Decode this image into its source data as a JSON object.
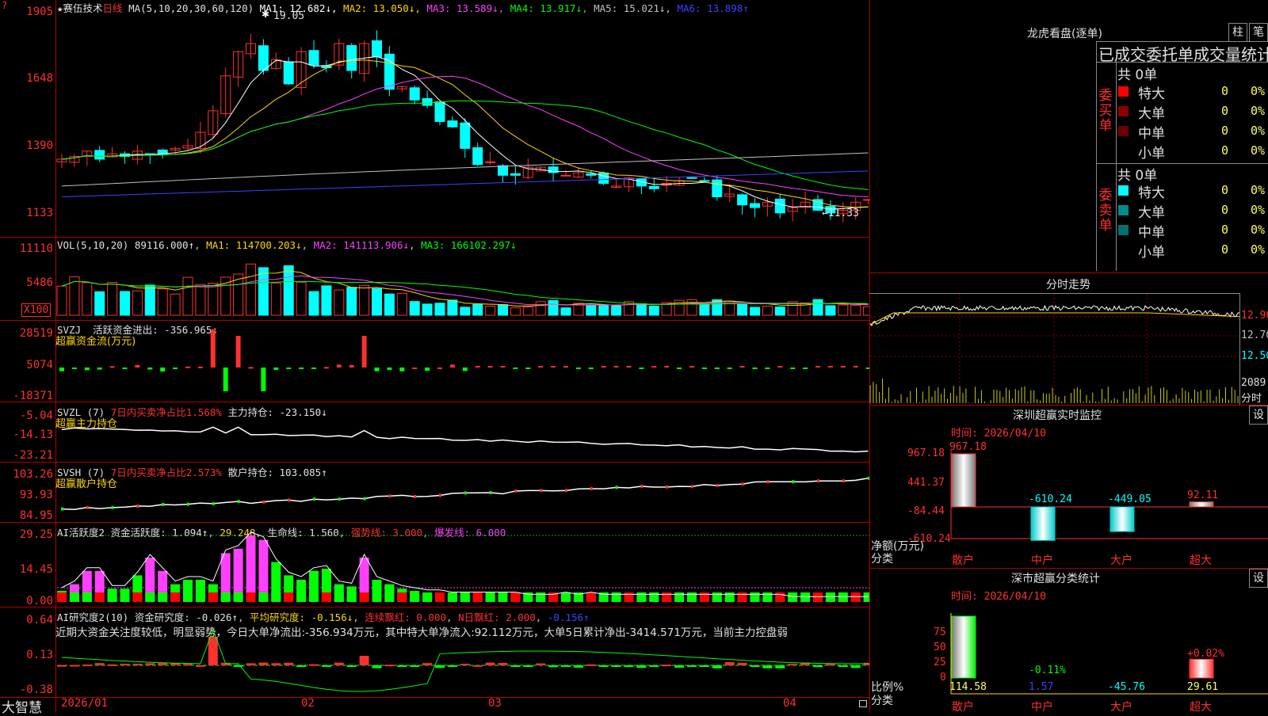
{
  "app": {
    "brand": "大智慧",
    "stock_name": "赛伍技术",
    "period": "日线",
    "star": "★",
    "marker": "?"
  },
  "price_panel": {
    "ma_header": "MA(5,10,20,30,60,120)",
    "ma_values": [
      {
        "label": "MA1:",
        "value": "12.682↓",
        "color": "#ffffff"
      },
      {
        "label": "MA2:",
        "value": "13.050↓",
        "color": "#ffd700"
      },
      {
        "label": "MA3:",
        "value": "13.589↓",
        "color": "#ff40ff"
      },
      {
        "label": "MA4:",
        "value": "13.917↓",
        "color": "#00ff00"
      },
      {
        "label": "MA5:",
        "value": "15.021↓",
        "color": "#c0c0c0"
      },
      {
        "label": "MA6:",
        "value": "13.898↑",
        "color": "#4040ff"
      }
    ],
    "y_ticks": [
      "1905",
      "1648",
      "1390",
      "1133"
    ],
    "high_label": "19.05",
    "low_label": "←11.33"
  },
  "vol_panel": {
    "header": "VOL(5,10,20)",
    "vol_value": "89116.000↑",
    "ma1": "MA1: 114700.203↓",
    "ma2": "MA2: 141113.906↓",
    "ma3": "MA3: 166102.297↓",
    "y_ticks": [
      "11110",
      "5486"
    ],
    "unit": "X100"
  },
  "svzj_panel": {
    "header": "SVZJ",
    "item": "活跃资金进出: -356.965↓",
    "caption": "超赢资金流(万元)",
    "y_ticks": [
      "28519",
      "5074",
      "-18371"
    ]
  },
  "svzl_panel": {
    "header": "SVZL (7)",
    "ratio": "7日内买卖净占比1.568%",
    "item": "主力持仓: -23.150↓",
    "caption": "超赢主力持仓",
    "y_ticks": [
      "-5.04",
      "-14.13",
      "-23.21"
    ]
  },
  "svsh_panel": {
    "header": "SVSH (7)",
    "ratio": "7日内买卖净占比2.573%",
    "item": "散户持仓: 103.085↑",
    "caption": "超赢散户持仓",
    "y_ticks": [
      "103.26",
      "93.93",
      "84.95"
    ]
  },
  "ai_active_panel": {
    "header": "AI活跃度2",
    "item1": "资金活跃度: 1.094↑",
    "item2": "29.248",
    "item3": "生命线: 1.560",
    "item4": "强势线: 3.000",
    "item5": "爆发线: 6.000",
    "y_ticks": [
      "29.25",
      "14.45",
      "0.00"
    ]
  },
  "ai_research_panel": {
    "header": "AI研究度2(10)",
    "item1": "资金研究度: -0.026↑",
    "item2": "平均研究度: -0.156↓",
    "item3": "连续飘红: 0.000",
    "item4": "N日飘红: 2.000",
    "item5": "-0.156↑",
    "summary": "近期大资金关注度较低，明显弱势，今日大单净流出:-356.934万元，其中特大单净流入:92.112万元，大单5日累计净出-3414.571万元，当前主力控盘弱",
    "y_ticks": [
      "0.64",
      "0.13",
      "-0.38"
    ]
  },
  "x_axis": {
    "dates": [
      "2026/01",
      "02",
      "03",
      "04"
    ]
  },
  "order_panel": {
    "title": "龙虎看盘(逐单)",
    "btn1": "柱",
    "btn2": "笔",
    "subtitle": "已成交委托单成交量统计",
    "buy": {
      "label": "委买单",
      "total": "共 0单",
      "rows": [
        {
          "name": "特大",
          "value": "0",
          "pct": "0%",
          "color": "#ff0000"
        },
        {
          "name": "大单",
          "value": "0",
          "pct": "0%",
          "color": "#8b0000"
        },
        {
          "name": "中单",
          "value": "0",
          "pct": "0%",
          "color": "#6b0000"
        },
        {
          "name": "小单",
          "value": "0",
          "pct": "0%",
          "color": "#000000"
        }
      ]
    },
    "sell": {
      "label": "委卖单",
      "total": "共 0单",
      "rows": [
        {
          "name": "特大",
          "value": "0",
          "pct": "0%",
          "color": "#00ffff"
        },
        {
          "name": "大单",
          "value": "0",
          "pct": "0%",
          "color": "#008b8b"
        },
        {
          "name": "中单",
          "value": "0",
          "pct": "0%",
          "color": "#007070"
        },
        {
          "name": "小单",
          "value": "0",
          "pct": "0%",
          "color": "#000000"
        }
      ]
    }
  },
  "intraday": {
    "title": "分时走势",
    "p1": "12.90",
    "p2": "12.70",
    "p3": "12.50",
    "vol": "2089",
    "unit": "分时"
  },
  "sz_monitor": {
    "title": "深圳超赢实时监控",
    "btn": "设",
    "time": "时间: 2026/04/10",
    "y_ticks": [
      "967.18",
      "441.37",
      "-84.44",
      "-610.24"
    ],
    "ylabel": "净额(万元)",
    "xlabel": "分类",
    "categories": [
      "散户",
      "中户",
      "大户",
      "超大"
    ],
    "values_text": [
      "967.18",
      "-610.24",
      "-449.05",
      "92.11"
    ]
  },
  "sz_class": {
    "title": "深市超赢分类统计",
    "btn": "设",
    "time": "时间: 2026/04/10",
    "y_ticks": [
      "75",
      "50",
      "25",
      "0"
    ],
    "ylabel": "比例%",
    "xlabel": "分类",
    "categories": [
      "散户",
      "中户",
      "大户",
      "超大"
    ],
    "values_text": [
      "114.58",
      "1.57",
      "-45.76",
      "29.61"
    ],
    "labels_above": [
      "",
      "-0.11%",
      "",
      "+0.02%"
    ]
  },
  "colors": {
    "up": "#ff3030",
    "down": "#00ffff",
    "border": "#b00000",
    "text_red": "#ff3030",
    "text_yellow": "#ffd700"
  }
}
